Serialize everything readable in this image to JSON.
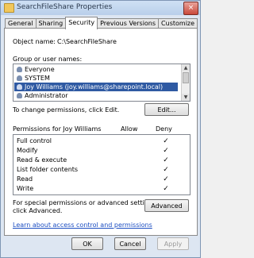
{
  "window": {
    "title": "SearchFileShare Properties",
    "close_glyph": "×"
  },
  "tabs": [
    "General",
    "Sharing",
    "Security",
    "Previous Versions",
    "Customize"
  ],
  "active_tab": 2,
  "object_name": {
    "label": "Object name:",
    "value": "C:\\SearchFileShare"
  },
  "groups": {
    "label": "Group or user names:",
    "items": [
      "Everyone",
      "SYSTEM",
      "Joy Williams (joy.williams@sharepoint.local)",
      "Administrator"
    ],
    "selected": 2
  },
  "change_permissions": {
    "text": "To change permissions, click Edit.",
    "edit_label": "Edit..."
  },
  "permissions": {
    "title": "Permissions for Joy Williams",
    "allow_header": "Allow",
    "deny_header": "Deny",
    "rows": [
      {
        "name": "Full control",
        "deny": "✓"
      },
      {
        "name": "Modify",
        "deny": "✓"
      },
      {
        "name": "Read & execute",
        "deny": "✓"
      },
      {
        "name": "List folder contents",
        "deny": "✓"
      },
      {
        "name": "Read",
        "deny": "✓"
      },
      {
        "name": "Write",
        "deny": "✓"
      }
    ]
  },
  "advanced": {
    "text_line1": "For special permissions or advanced settings,",
    "text_line2": "click Advanced.",
    "button_label": "Advanced"
  },
  "learn_link": "Learn about access control and permissions",
  "footer": {
    "ok": "OK",
    "cancel": "Cancel",
    "apply": "Apply"
  }
}
